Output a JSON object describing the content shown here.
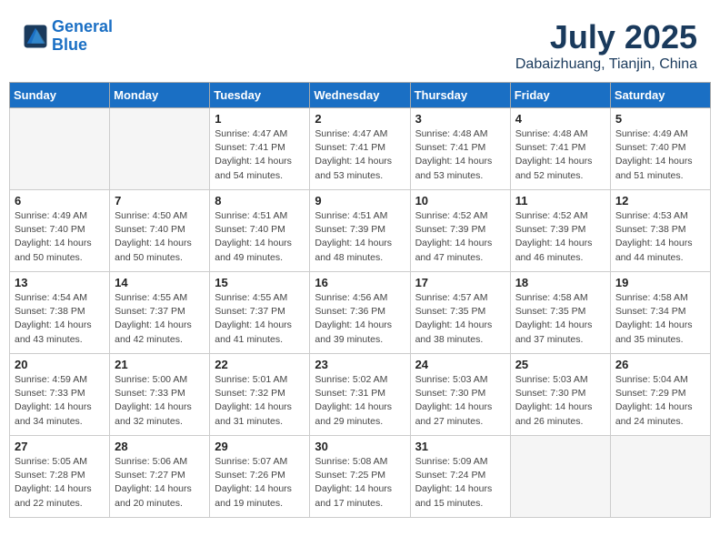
{
  "header": {
    "logo_line1": "General",
    "logo_line2": "Blue",
    "main_title": "July 2025",
    "sub_title": "Dabaizhuang, Tianjin, China"
  },
  "days_of_week": [
    "Sunday",
    "Monday",
    "Tuesday",
    "Wednesday",
    "Thursday",
    "Friday",
    "Saturday"
  ],
  "weeks": [
    [
      {
        "day": "",
        "sunrise": "",
        "sunset": "",
        "daylight": ""
      },
      {
        "day": "",
        "sunrise": "",
        "sunset": "",
        "daylight": ""
      },
      {
        "day": "1",
        "sunrise": "Sunrise: 4:47 AM",
        "sunset": "Sunset: 7:41 PM",
        "daylight": "Daylight: 14 hours and 54 minutes."
      },
      {
        "day": "2",
        "sunrise": "Sunrise: 4:47 AM",
        "sunset": "Sunset: 7:41 PM",
        "daylight": "Daylight: 14 hours and 53 minutes."
      },
      {
        "day": "3",
        "sunrise": "Sunrise: 4:48 AM",
        "sunset": "Sunset: 7:41 PM",
        "daylight": "Daylight: 14 hours and 53 minutes."
      },
      {
        "day": "4",
        "sunrise": "Sunrise: 4:48 AM",
        "sunset": "Sunset: 7:41 PM",
        "daylight": "Daylight: 14 hours and 52 minutes."
      },
      {
        "day": "5",
        "sunrise": "Sunrise: 4:49 AM",
        "sunset": "Sunset: 7:40 PM",
        "daylight": "Daylight: 14 hours and 51 minutes."
      }
    ],
    [
      {
        "day": "6",
        "sunrise": "Sunrise: 4:49 AM",
        "sunset": "Sunset: 7:40 PM",
        "daylight": "Daylight: 14 hours and 50 minutes."
      },
      {
        "day": "7",
        "sunrise": "Sunrise: 4:50 AM",
        "sunset": "Sunset: 7:40 PM",
        "daylight": "Daylight: 14 hours and 50 minutes."
      },
      {
        "day": "8",
        "sunrise": "Sunrise: 4:51 AM",
        "sunset": "Sunset: 7:40 PM",
        "daylight": "Daylight: 14 hours and 49 minutes."
      },
      {
        "day": "9",
        "sunrise": "Sunrise: 4:51 AM",
        "sunset": "Sunset: 7:39 PM",
        "daylight": "Daylight: 14 hours and 48 minutes."
      },
      {
        "day": "10",
        "sunrise": "Sunrise: 4:52 AM",
        "sunset": "Sunset: 7:39 PM",
        "daylight": "Daylight: 14 hours and 47 minutes."
      },
      {
        "day": "11",
        "sunrise": "Sunrise: 4:52 AM",
        "sunset": "Sunset: 7:39 PM",
        "daylight": "Daylight: 14 hours and 46 minutes."
      },
      {
        "day": "12",
        "sunrise": "Sunrise: 4:53 AM",
        "sunset": "Sunset: 7:38 PM",
        "daylight": "Daylight: 14 hours and 44 minutes."
      }
    ],
    [
      {
        "day": "13",
        "sunrise": "Sunrise: 4:54 AM",
        "sunset": "Sunset: 7:38 PM",
        "daylight": "Daylight: 14 hours and 43 minutes."
      },
      {
        "day": "14",
        "sunrise": "Sunrise: 4:55 AM",
        "sunset": "Sunset: 7:37 PM",
        "daylight": "Daylight: 14 hours and 42 minutes."
      },
      {
        "day": "15",
        "sunrise": "Sunrise: 4:55 AM",
        "sunset": "Sunset: 7:37 PM",
        "daylight": "Daylight: 14 hours and 41 minutes."
      },
      {
        "day": "16",
        "sunrise": "Sunrise: 4:56 AM",
        "sunset": "Sunset: 7:36 PM",
        "daylight": "Daylight: 14 hours and 39 minutes."
      },
      {
        "day": "17",
        "sunrise": "Sunrise: 4:57 AM",
        "sunset": "Sunset: 7:35 PM",
        "daylight": "Daylight: 14 hours and 38 minutes."
      },
      {
        "day": "18",
        "sunrise": "Sunrise: 4:58 AM",
        "sunset": "Sunset: 7:35 PM",
        "daylight": "Daylight: 14 hours and 37 minutes."
      },
      {
        "day": "19",
        "sunrise": "Sunrise: 4:58 AM",
        "sunset": "Sunset: 7:34 PM",
        "daylight": "Daylight: 14 hours and 35 minutes."
      }
    ],
    [
      {
        "day": "20",
        "sunrise": "Sunrise: 4:59 AM",
        "sunset": "Sunset: 7:33 PM",
        "daylight": "Daylight: 14 hours and 34 minutes."
      },
      {
        "day": "21",
        "sunrise": "Sunrise: 5:00 AM",
        "sunset": "Sunset: 7:33 PM",
        "daylight": "Daylight: 14 hours and 32 minutes."
      },
      {
        "day": "22",
        "sunrise": "Sunrise: 5:01 AM",
        "sunset": "Sunset: 7:32 PM",
        "daylight": "Daylight: 14 hours and 31 minutes."
      },
      {
        "day": "23",
        "sunrise": "Sunrise: 5:02 AM",
        "sunset": "Sunset: 7:31 PM",
        "daylight": "Daylight: 14 hours and 29 minutes."
      },
      {
        "day": "24",
        "sunrise": "Sunrise: 5:03 AM",
        "sunset": "Sunset: 7:30 PM",
        "daylight": "Daylight: 14 hours and 27 minutes."
      },
      {
        "day": "25",
        "sunrise": "Sunrise: 5:03 AM",
        "sunset": "Sunset: 7:30 PM",
        "daylight": "Daylight: 14 hours and 26 minutes."
      },
      {
        "day": "26",
        "sunrise": "Sunrise: 5:04 AM",
        "sunset": "Sunset: 7:29 PM",
        "daylight": "Daylight: 14 hours and 24 minutes."
      }
    ],
    [
      {
        "day": "27",
        "sunrise": "Sunrise: 5:05 AM",
        "sunset": "Sunset: 7:28 PM",
        "daylight": "Daylight: 14 hours and 22 minutes."
      },
      {
        "day": "28",
        "sunrise": "Sunrise: 5:06 AM",
        "sunset": "Sunset: 7:27 PM",
        "daylight": "Daylight: 14 hours and 20 minutes."
      },
      {
        "day": "29",
        "sunrise": "Sunrise: 5:07 AM",
        "sunset": "Sunset: 7:26 PM",
        "daylight": "Daylight: 14 hours and 19 minutes."
      },
      {
        "day": "30",
        "sunrise": "Sunrise: 5:08 AM",
        "sunset": "Sunset: 7:25 PM",
        "daylight": "Daylight: 14 hours and 17 minutes."
      },
      {
        "day": "31",
        "sunrise": "Sunrise: 5:09 AM",
        "sunset": "Sunset: 7:24 PM",
        "daylight": "Daylight: 14 hours and 15 minutes."
      },
      {
        "day": "",
        "sunrise": "",
        "sunset": "",
        "daylight": ""
      },
      {
        "day": "",
        "sunrise": "",
        "sunset": "",
        "daylight": ""
      }
    ]
  ]
}
